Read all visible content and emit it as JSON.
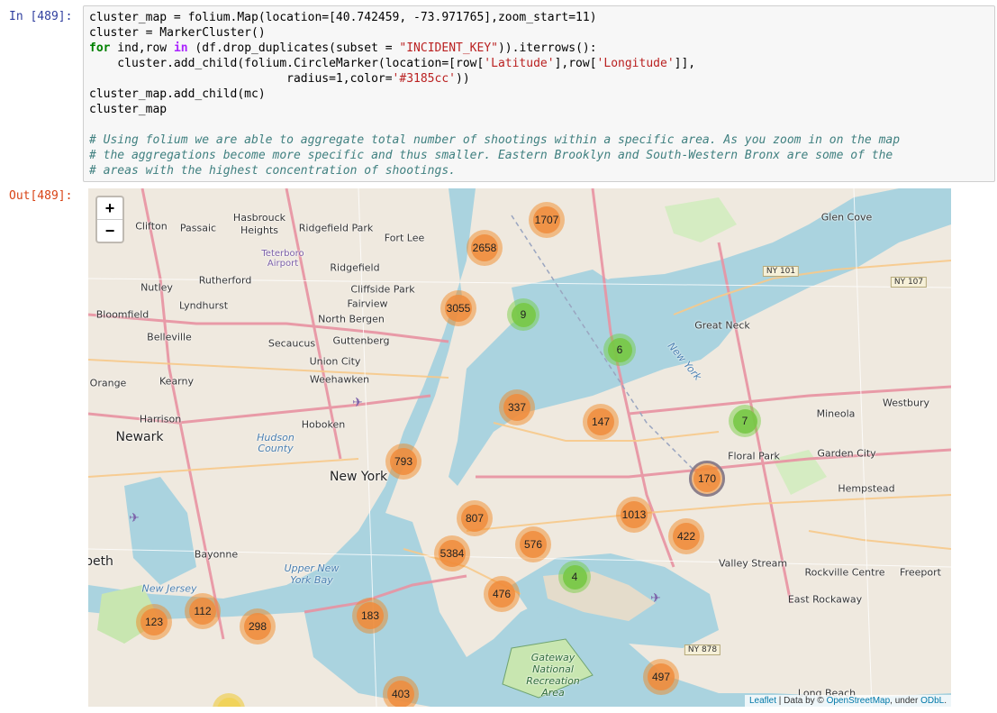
{
  "notebook": {
    "in_prompt": "In [489]:",
    "out_prompt": "Out[489]:"
  },
  "code": {
    "l1": "cluster_map = folium.Map(location=[40.742459, -73.971765],zoom_start=11)",
    "l2": "cluster = MarkerCluster()",
    "l3_kw": "for",
    "l3_a": " ind,row ",
    "l3_in": "in",
    "l3_b": " (df.drop_duplicates(subset = ",
    "l3_str": "\"INCIDENT_KEY\"",
    "l3_c": ")).iterrows():",
    "l4_a": "    cluster.add_child(folium.CircleMarker(location=[row[",
    "l4_s1": "'Latitude'",
    "l4_b": "],row[",
    "l4_s2": "'Longitude'",
    "l4_c": "]],",
    "l5_a": "                            radius=1,color=",
    "l5_s": "'#3185cc'",
    "l5_b": "))",
    "l6": "cluster_map.add_child(mc)",
    "l7": "cluster_map",
    "c1": "# Using folium we are able to aggregate total number of shootings within a specific area. As you zoom in on the map",
    "c2": "# the aggregations become more specific and thus smaller. Eastern Brooklyn and South-Western Bronx are some of the",
    "c3": "# areas with the highest concentration of shootings."
  },
  "map": {
    "zoom_in": "+",
    "zoom_out": "−",
    "attribution": {
      "leaflet": "Leaflet",
      "sep1": " | Data by © ",
      "osm": "OpenStreetMap",
      "sep2": ", under ",
      "odbl": "ODbL",
      "end": "."
    },
    "colors": {
      "orange": "#f08c3c",
      "green": "#78c846",
      "yellow": "#f1d357",
      "selected_ring": "#3b7ee8"
    },
    "clusters": [
      {
        "count": "1707",
        "color": "orange"
      },
      {
        "count": "2658",
        "color": "orange"
      },
      {
        "count": "3055",
        "color": "orange"
      },
      {
        "count": "9",
        "color": "green"
      },
      {
        "count": "6",
        "color": "green"
      },
      {
        "count": "337",
        "color": "orange"
      },
      {
        "count": "147",
        "color": "orange"
      },
      {
        "count": "7",
        "color": "green"
      },
      {
        "count": "793",
        "color": "orange"
      },
      {
        "count": "170",
        "color": "orange"
      },
      {
        "count": "807",
        "color": "orange"
      },
      {
        "count": "1013",
        "color": "orange"
      },
      {
        "count": "422",
        "color": "orange"
      },
      {
        "count": "576",
        "color": "orange"
      },
      {
        "count": "5384",
        "color": "orange"
      },
      {
        "count": "4",
        "color": "green"
      },
      {
        "count": "476",
        "color": "orange"
      },
      {
        "count": "112",
        "color": "orange"
      },
      {
        "count": "123",
        "color": "orange"
      },
      {
        "count": "298",
        "color": "orange"
      },
      {
        "count": "183",
        "color": "orange"
      },
      {
        "count": "497",
        "color": "orange"
      },
      {
        "count": "403",
        "color": "orange"
      },
      {
        "count": "",
        "color": "yellow"
      }
    ],
    "places": {
      "clifton": "Clifton",
      "passaic": "Passaic",
      "hasbrouck": "Hasbrouck\nHeights",
      "ridgefield_park": "Ridgefield Park",
      "fort_lee": "Fort Lee",
      "glen_cove": "Glen Cove",
      "teterboro": "Teterboro\nAirport",
      "ridgefield": "Ridgefield",
      "rutherford": "Rutherford",
      "nutley": "Nutley",
      "cliffside": "Cliffside Park",
      "fairview": "Fairview",
      "lyndhurst": "Lyndhurst",
      "bloomfield": "Bloomfield",
      "north_bergen": "North Bergen",
      "great_neck": "Great Neck",
      "belleville": "Belleville",
      "secaucus": "Secaucus",
      "guttenberg": "Guttenberg",
      "union_city": "Union City",
      "weehawken": "Weehawken",
      "orange": "Orange",
      "kearny": "Kearny",
      "harrison": "Harrison",
      "hoboken": "Hoboken",
      "newark": "Newark",
      "hudson_county": "Hudson\nCounty",
      "new_york": "New York",
      "mineola": "Mineola",
      "westbury": "Westbury",
      "garden_city": "Garden City",
      "floral_park": "Floral Park",
      "hempstead": "Hempstead",
      "bayonne": "Bayonne",
      "elizabeth": "beth",
      "upper_ny_bay": "Upper New\nYork Bay",
      "valley_stream": "Valley Stream",
      "rockville_centre": "Rockville Centre",
      "freeport": "Freeport",
      "east_rockaway": "East Rockaway",
      "new_jersey": "New Jersey",
      "gateway": "Gateway\nNational\nRecreation\nArea",
      "long_beach": "Long Beach",
      "new_york_state": "New York"
    },
    "highways": {
      "ny101": "NY 101",
      "ny107": "NY 107",
      "ny878": "NY 878"
    }
  }
}
